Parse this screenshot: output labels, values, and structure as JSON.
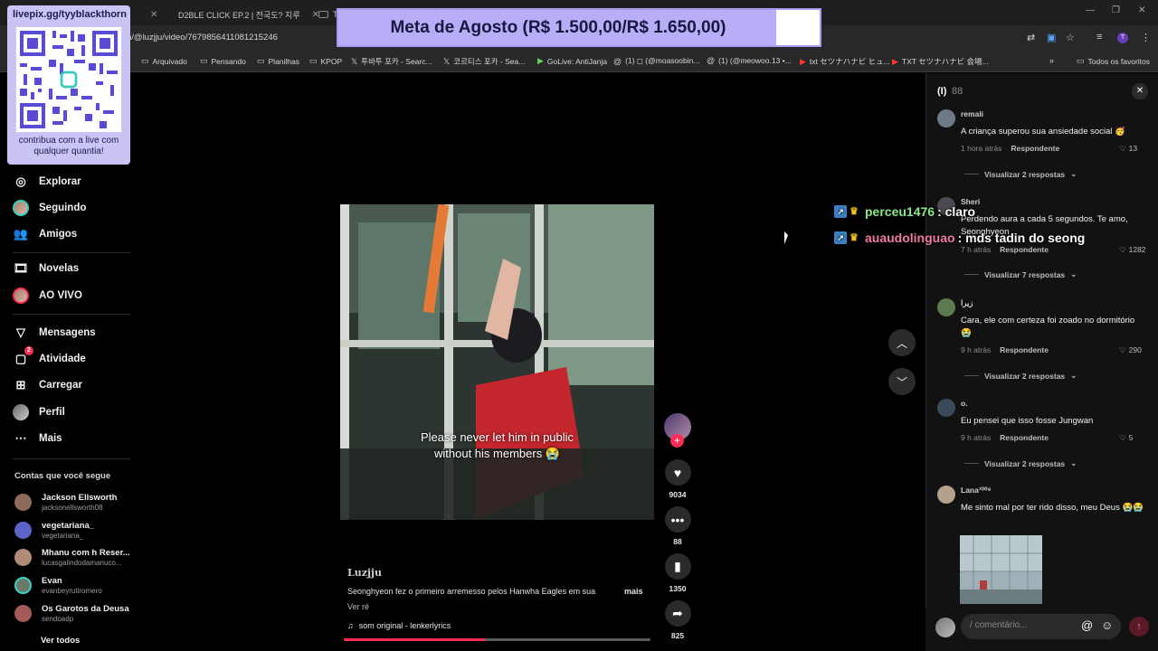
{
  "browser": {
    "tabs": [
      {
        "label": "D2BLE CLICK EP.2 | 전국도? 지루",
        "favicon_color": "#ff0000"
      },
      {
        "label": "Ti",
        "favicon_color": "#222222"
      }
    ],
    "url": "n/@luzjju/video/7679856411081215246",
    "bookmarks": [
      {
        "label": "Arquivado",
        "icon": "folder-icon"
      },
      {
        "label": "Pensando",
        "icon": "folder-icon"
      },
      {
        "label": "Planilhas",
        "icon": "folder-icon"
      },
      {
        "label": "KPOP",
        "icon": "folder-icon"
      },
      {
        "label": "투바투 포카 - Searc...",
        "icon": "x-icon"
      },
      {
        "label": "코르티스 포카 - Sea...",
        "icon": "x-icon"
      },
      {
        "label": "GoLive: AntiJanja",
        "icon": "golive-icon"
      },
      {
        "label": "(1) ◻ (@moasoobin...",
        "icon": "threads-icon"
      },
      {
        "label": "(1) (@meowoo.13 •...",
        "icon": "threads-icon"
      },
      {
        "label": "txt セツナハナビ ヒュ...",
        "icon": "youtube-icon"
      },
      {
        "label": "TXT セツナハナビ 会場...",
        "icon": "youtube-icon"
      }
    ],
    "all_favorites": "Todos os favoritos"
  },
  "overlay": {
    "qr_title": "livepix.gg/tyyblackthorn",
    "qr_caption": "contribua com a live com qualquer quantia!",
    "goal_text": "Meta de Agosto (R$ 1.500,00/R$ 1.650,00)",
    "goal_progress": 0.909,
    "goal_color": "#b8aef7"
  },
  "sidebar": {
    "nav": [
      {
        "label": "Explorar",
        "icon": "compass-icon"
      },
      {
        "label": "Seguindo",
        "icon": "avatar-icon"
      },
      {
        "label": "Amigos",
        "icon": "friends-icon"
      },
      {
        "label": "Novelas",
        "icon": "film-icon"
      },
      {
        "label": "AO VIVO",
        "icon": "avatar-icon"
      },
      {
        "label": "Mensagens",
        "icon": "send-icon"
      },
      {
        "label": "Atividade",
        "icon": "activity-icon",
        "badge": "2"
      },
      {
        "label": "Carregar",
        "icon": "upload-icon"
      },
      {
        "label": "Perfil",
        "icon": "profile-icon"
      },
      {
        "label": "Mais",
        "icon": "more-icon"
      }
    ],
    "following_title": "Contas que você segue",
    "following": [
      {
        "name": "Jackson Ellsworth",
        "user": "jacksonellsworth08",
        "color": "#8d6a5a"
      },
      {
        "name": "vegetariana_",
        "user": "vegetariana_",
        "color": "#5b62c8"
      },
      {
        "name": "Mhanu com h Reser...",
        "user": "lucasgalindodamanuco...",
        "color": "#b08c78"
      },
      {
        "name": "Evan",
        "user": "evanbeyrutiromero",
        "color": "#6a7a6a"
      },
      {
        "name": "Os Garotos da Deusa",
        "user": "sendoadp",
        "color": "#a55a5a"
      }
    ],
    "see_all": "Ver todos"
  },
  "video": {
    "caption": "Please never let him in public\nwithout his members 😭",
    "author": "Luzjju",
    "description": "Seonghyeon fez o primeiro arremesso pelos Hanwha Eagles em sua",
    "more": "mais",
    "see_translation": "Ver ré",
    "sound": "som original - lenkerlyrics",
    "progress": 0.46,
    "likes": "9034",
    "comments": "88",
    "saves": "1350",
    "shares": "825"
  },
  "live_chat": [
    {
      "user": "perceu1476",
      "message": ": claro",
      "color": "#8ee68a"
    },
    {
      "user": "auaudolinguao",
      "message": ": mds tadin do seong",
      "color": "#f07aa0"
    }
  ],
  "comments_panel": {
    "title": "(I)",
    "count": "88",
    "comments": [
      {
        "user": "remali",
        "text": "A criança superou sua ansiedade social 🥳",
        "time": "1 hora atrás",
        "reply": "Respondente",
        "likes": "13",
        "replies": "Visualizar 2 respostas",
        "avatar": "#6b7a86"
      },
      {
        "user": "Sheri",
        "text": "Perdendo aura a cada 5 segundos. Te amo, Seonghyeon",
        "time": "7 h atrás",
        "reply": "Respondente",
        "likes": "1282",
        "replies": "Visualizar 7 respostas",
        "avatar": "#4a4a52"
      },
      {
        "user": "زيرا",
        "text": "Cara, ele com certeza foi zoado no dormitório 😭",
        "time": "9 h atrás",
        "reply": "Respondente",
        "likes": "290",
        "replies": "Visualizar 2 respostas",
        "avatar": "#5d7a4e"
      },
      {
        "user": "o.",
        "text": "Eu pensei que isso fosse Jungwan",
        "time": "9 h atrás",
        "reply": "Respondente",
        "likes": "5",
        "replies": "Visualizar 2 respostas",
        "avatar": "#3a4a5a"
      },
      {
        "user": "Lana¹⁰⁰⁹",
        "text": "Me sinto mal por ter rido disso, meu Deus 😭😭",
        "avatar": "#b5a08e"
      }
    ],
    "input_placeholder": "comentário..."
  }
}
